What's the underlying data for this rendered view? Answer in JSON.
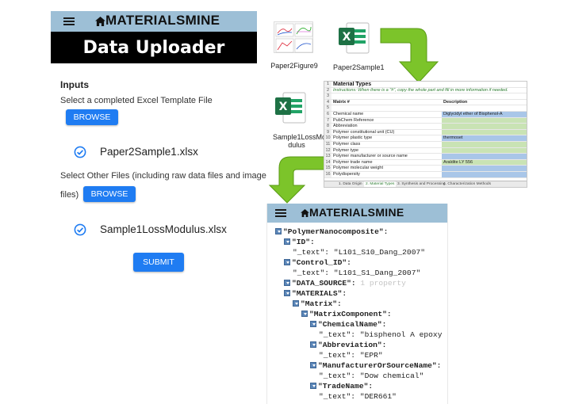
{
  "app": {
    "brand": "MATERIALSMINE",
    "page_title": "Data Uploader"
  },
  "uploader": {
    "inputs_heading": "Inputs",
    "excel_prompt": "Select a completed Excel Template File",
    "browse_label": "BROWSE",
    "excel_file": "Paper2Sample1.xlsx",
    "other_prompt_line1": "Select Other Files (including raw data files and image",
    "other_prompt_line2": "files)",
    "other_browse_label": "BROWSE",
    "other_file": "Sample1LossModulus.xlsx",
    "submit_label": "SUBMIT"
  },
  "thumbnails": [
    {
      "label": "Paper2Figure9"
    },
    {
      "label": "Paper2Sample1"
    },
    {
      "label": "Sample1LossMo dulus",
      "label_line1": "Sample1LossMo",
      "label_line2": "dulus"
    }
  ],
  "sheet": {
    "title": "Material Types",
    "instructions": "Instructions: When there is a \"#\", copy the whole part and fill in more information if needed.",
    "col_a_header": "Matrix #",
    "col_b_header": "Description",
    "rows": [
      {
        "n": "1",
        "a": "Material Types",
        "b": ""
      },
      {
        "n": "2",
        "a": "Instructions: When there is a \"#\", copy the whole part and fill in more information if needed.",
        "b": ""
      },
      {
        "n": "3",
        "a": "",
        "b": ""
      },
      {
        "n": "4",
        "a": "Matrix #",
        "b": "Description"
      },
      {
        "n": "5",
        "a": "",
        "b": ""
      },
      {
        "n": "6",
        "a": "Chemical name",
        "b": "Diglycidyl ether of Bisphenol-A"
      },
      {
        "n": "7",
        "a": "PubChem Reference",
        "b": ""
      },
      {
        "n": "8",
        "a": "Abbreviation",
        "b": ""
      },
      {
        "n": "9",
        "a": "Polymer constitutional unit (CU)",
        "b": ""
      },
      {
        "n": "10",
        "a": "Polymer plastic type",
        "b": "thermoset"
      },
      {
        "n": "11",
        "a": "Polymer class",
        "b": ""
      },
      {
        "n": "12",
        "a": "Polymer type",
        "b": ""
      },
      {
        "n": "13",
        "a": "Polymer manufacturer or source name",
        "b": ""
      },
      {
        "n": "14",
        "a": "Polymer trade name",
        "b": "Araldite LY 556"
      },
      {
        "n": "15",
        "a": "Polymer molecular weight",
        "b": ""
      },
      {
        "n": "16",
        "a": "Polydispersity",
        "b": ""
      }
    ],
    "tabs": [
      "1. Data Origin",
      "2. Material Types",
      "3. Synthesis and Processing",
      "4. Characterization Methods"
    ],
    "colors": {
      "title_green": "#2e7d32",
      "cell_blue": "#a9c6e8",
      "cell_green": "#c9e3b4"
    }
  },
  "json_tree": {
    "brand": "MATERIALSMINE",
    "lines": [
      {
        "indent": 0,
        "toggle": true,
        "key": "\"PolymerNanocomposite\"",
        "sep": ":",
        "value": "",
        "hint": ""
      },
      {
        "indent": 1,
        "toggle": true,
        "key": "\"ID\"",
        "sep": ":",
        "value": "",
        "hint": ""
      },
      {
        "indent": 2,
        "toggle": false,
        "key": "\"_text\"",
        "sep": ":",
        "value": " \"L101_S10_Dang_2007\"",
        "hint": ""
      },
      {
        "indent": 1,
        "toggle": true,
        "key": "\"Control_ID\"",
        "sep": ":",
        "value": "",
        "hint": ""
      },
      {
        "indent": 2,
        "toggle": false,
        "key": "\"_text\"",
        "sep": ":",
        "value": " \"L101_S1_Dang_2007\"",
        "hint": ""
      },
      {
        "indent": 1,
        "toggle": true,
        "key": "\"DATA_SOURCE\"",
        "sep": ":",
        "value": "",
        "hint": " 1 property"
      },
      {
        "indent": 1,
        "toggle": true,
        "key": "\"MATERIALS\"",
        "sep": ":",
        "value": "",
        "hint": ""
      },
      {
        "indent": 2,
        "toggle": true,
        "key": "\"Matrix\"",
        "sep": ":",
        "value": "",
        "hint": ""
      },
      {
        "indent": 3,
        "toggle": true,
        "key": "\"MatrixComponent\"",
        "sep": ":",
        "value": "",
        "hint": ""
      },
      {
        "indent": 4,
        "toggle": true,
        "key": "\"ChemicalName\"",
        "sep": ":",
        "value": "",
        "hint": ""
      },
      {
        "indent": 5,
        "toggle": false,
        "key": "\"_text\"",
        "sep": ":",
        "value": " \"bisphenol A epoxy r",
        "hint": ""
      },
      {
        "indent": 4,
        "toggle": true,
        "key": "\"Abbreviation\"",
        "sep": ":",
        "value": "",
        "hint": ""
      },
      {
        "indent": 5,
        "toggle": false,
        "key": "\"_text\"",
        "sep": ":",
        "value": " \"EPR\"",
        "hint": ""
      },
      {
        "indent": 4,
        "toggle": true,
        "key": "\"ManufacturerOrSourceName\"",
        "sep": ":",
        "value": "",
        "hint": ""
      },
      {
        "indent": 5,
        "toggle": false,
        "key": "\"_text\"",
        "sep": ":",
        "value": " \"Dow chemical\"",
        "hint": ""
      },
      {
        "indent": 4,
        "toggle": true,
        "key": "\"TradeName\"",
        "sep": ":",
        "value": "",
        "hint": ""
      },
      {
        "indent": 5,
        "toggle": false,
        "key": "\"_text\"",
        "sep": ":",
        "value": " \"DER661\"",
        "hint": ""
      }
    ]
  },
  "colors": {
    "header_bar": "#9dbfd6",
    "button_blue": "#1f7cf2",
    "arrow_green": "#7cc42a",
    "excel_green": "#1e7145",
    "check_blue": "#1f7cf2"
  }
}
